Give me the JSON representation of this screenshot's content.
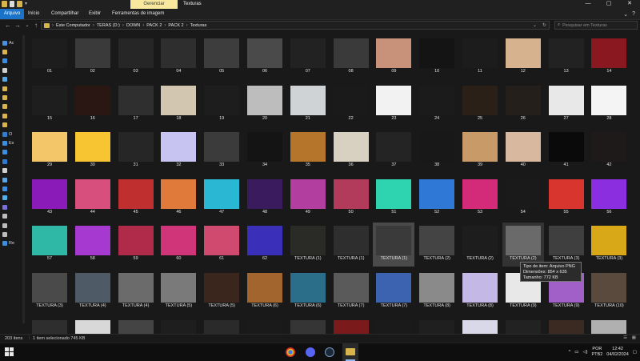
{
  "window": {
    "contextual_tab": "Gerenciar",
    "title": "Texturas",
    "controls": [
      "—",
      "▢",
      "✕"
    ]
  },
  "ribbon": {
    "tabs": [
      "Arquivo",
      "Início",
      "Compartilhar",
      "Exibir",
      "Ferramentas de imagem"
    ]
  },
  "address": {
    "crumbs": [
      "Este Computador",
      "TERAS (D:)",
      "DOWN",
      "PACK 2",
      "PACK 2",
      "Texturas"
    ],
    "separator": "›"
  },
  "search": {
    "placeholder": "Pesquisar em Texturas"
  },
  "sidebar": {
    "items": [
      {
        "label": "Ac",
        "icon": "star-icon",
        "color": "#4a90e2"
      },
      {
        "label": "",
        "icon": "folder-icon",
        "color": "#d8b44a"
      },
      {
        "label": "",
        "icon": "download-icon",
        "color": "#3b8fe0"
      },
      {
        "label": "",
        "icon": "document-icon",
        "color": "#cfcfcf"
      },
      {
        "label": "",
        "icon": "image-icon",
        "color": "#58a6e6"
      },
      {
        "label": "",
        "icon": "folder-icon",
        "color": "#d8b44a"
      },
      {
        "label": "",
        "icon": "folder-icon",
        "color": "#d8b44a"
      },
      {
        "label": "",
        "icon": "folder-icon",
        "color": "#d8b44a"
      },
      {
        "label": "",
        "icon": "folder-icon",
        "color": "#d8b44a"
      },
      {
        "label": "",
        "icon": "folder-icon",
        "color": "#d8b44a"
      },
      {
        "label": "O",
        "icon": "onedrive-icon",
        "color": "#2d7fd3"
      },
      {
        "label": "Es",
        "icon": "computer-icon",
        "color": "#3b8fe0"
      },
      {
        "label": "",
        "icon": "download-icon",
        "color": "#3b8fe0"
      },
      {
        "label": "",
        "icon": "desktop-icon",
        "color": "#2b7cd1"
      },
      {
        "label": "",
        "icon": "document-icon",
        "color": "#cfcfcf"
      },
      {
        "label": "",
        "icon": "image-icon",
        "color": "#58a6e6"
      },
      {
        "label": "",
        "icon": "music-icon",
        "color": "#3b8fe0"
      },
      {
        "label": "",
        "icon": "3d-objects-icon",
        "color": "#4db0e8"
      },
      {
        "label": "",
        "icon": "video-icon",
        "color": "#7a6fd6"
      },
      {
        "label": "",
        "icon": "drive-icon",
        "color": "#bdbdbd"
      },
      {
        "label": "",
        "icon": "drive-icon",
        "color": "#bdbdbd"
      },
      {
        "label": "",
        "icon": "drive-icon",
        "color": "#bdbdbd"
      },
      {
        "label": "Re",
        "icon": "network-icon",
        "color": "#3b8fe0"
      }
    ]
  },
  "files": [
    {
      "label": "01",
      "fill": "#1d1d1d"
    },
    {
      "label": "02",
      "fill": "#3a3a3a"
    },
    {
      "label": "03",
      "fill": "#262626"
    },
    {
      "label": "04",
      "fill": "#2e2e2e"
    },
    {
      "label": "05",
      "fill": "#3d3d3d"
    },
    {
      "label": "06",
      "fill": "#4a4a4a"
    },
    {
      "label": "07",
      "fill": "#222222"
    },
    {
      "label": "08",
      "fill": "#3a3a3a"
    },
    {
      "label": "09",
      "fill": "#c8927a"
    },
    {
      "label": "10",
      "fill": "#141414"
    },
    {
      "label": "11",
      "fill": "#1c1c1c"
    },
    {
      "label": "12",
      "fill": "#d7b28e"
    },
    {
      "label": "13",
      "fill": "#222222"
    },
    {
      "label": "14",
      "fill": "#8a1820"
    },
    {
      "label": "15",
      "fill": "#1e1e1e"
    },
    {
      "label": "16",
      "fill": "#2a1612"
    },
    {
      "label": "17",
      "fill": "#2f2f2f"
    },
    {
      "label": "18",
      "fill": "#d2c6b0"
    },
    {
      "label": "19",
      "fill": "#1d1d1d"
    },
    {
      "label": "20",
      "fill": "#bdbdbd"
    },
    {
      "label": "21",
      "fill": "#cfd3d6"
    },
    {
      "label": "22",
      "fill": "#1a1a1a"
    },
    {
      "label": "23",
      "fill": "#f2f2f2"
    },
    {
      "label": "24",
      "fill": "#1b1b1b"
    },
    {
      "label": "25",
      "fill": "#2a2018"
    },
    {
      "label": "26",
      "fill": "#241f1a"
    },
    {
      "label": "27",
      "fill": "#e8e8e8"
    },
    {
      "label": "28",
      "fill": "#f4f4f4"
    },
    {
      "label": "29",
      "fill": "#f3c66a"
    },
    {
      "label": "30",
      "fill": "#f7c531"
    },
    {
      "label": "31",
      "fill": "#262626"
    },
    {
      "label": "32",
      "fill": "#c8c4f2"
    },
    {
      "label": "33",
      "fill": "#3b3b3b"
    },
    {
      "label": "34",
      "fill": "#141414"
    },
    {
      "label": "35",
      "fill": "#b5762c"
    },
    {
      "label": "36",
      "fill": "#d8d0c0"
    },
    {
      "label": "37",
      "fill": "#242424"
    },
    {
      "label": "38",
      "fill": "#181818"
    },
    {
      "label": "39",
      "fill": "#c89a68"
    },
    {
      "label": "40",
      "fill": "#d8b89e"
    },
    {
      "label": "41",
      "fill": "#0a0a0a"
    },
    {
      "label": "42",
      "fill": "#1f1a1a"
    },
    {
      "label": "43",
      "fill": "#8a1bb8"
    },
    {
      "label": "44",
      "fill": "#d74f7c"
    },
    {
      "label": "45",
      "fill": "#c02f2f"
    },
    {
      "label": "46",
      "fill": "#e07a3b"
    },
    {
      "label": "47",
      "fill": "#2ab7d4"
    },
    {
      "label": "48",
      "fill": "#3a1b5e"
    },
    {
      "label": "49",
      "fill": "#b23f9f"
    },
    {
      "label": "50",
      "fill": "#b23a5a"
    },
    {
      "label": "51",
      "fill": "#2ed3b0"
    },
    {
      "label": "52",
      "fill": "#2f78d6"
    },
    {
      "label": "53",
      "fill": "#d42a7a"
    },
    {
      "label": "54",
      "fill": "#1a1a1a"
    },
    {
      "label": "55",
      "fill": "#d8352f"
    },
    {
      "label": "56",
      "fill": "#8b2ee0"
    },
    {
      "label": "57",
      "fill": "#2fb8a6"
    },
    {
      "label": "58",
      "fill": "#a63ad0"
    },
    {
      "label": "59",
      "fill": "#b02a4a"
    },
    {
      "label": "60",
      "fill": "#d0357a"
    },
    {
      "label": "61",
      "fill": "#d04a6f"
    },
    {
      "label": "62",
      "fill": "#3a2fb8"
    },
    {
      "label": "TEXTURA (1)",
      "fill": "#2a2a26"
    },
    {
      "label": "TEXTURA (1)",
      "fill": "#2e2e2e"
    },
    {
      "label": "TEXTURA (1)",
      "fill": "#3a3a3a",
      "selected": true
    },
    {
      "label": "TEXTURA (2)",
      "fill": "#444444"
    },
    {
      "label": "TEXTURA (2)",
      "fill": "#1d1d1d"
    },
    {
      "label": "TEXTURA (2)",
      "fill": "#6a6a6a",
      "hover": true
    },
    {
      "label": "TEXTURA (3)",
      "fill": "#3f3f3f"
    },
    {
      "label": "TEXTURA (3)",
      "fill": "#d9a818"
    },
    {
      "label": "TEXTURA (3)",
      "fill": "#4a4a4a"
    },
    {
      "label": "TEXTURA (4)",
      "fill": "#4e5a66"
    },
    {
      "label": "TEXTURA (4)",
      "fill": "#6b6b6b"
    },
    {
      "label": "TEXTURA (5)",
      "fill": "#7a7a7a"
    },
    {
      "label": "TEXTURA (5)",
      "fill": "#3a261c"
    },
    {
      "label": "TEXTURA (6)",
      "fill": "#a2652e"
    },
    {
      "label": "TEXTURA (6)",
      "fill": "#2a6e8a"
    },
    {
      "label": "TEXTURA (7)",
      "fill": "#5a5a5a"
    },
    {
      "label": "TEXTURA (7)",
      "fill": "#3b63b0"
    },
    {
      "label": "TEXTURA (8)",
      "fill": "#8a8a8a"
    },
    {
      "label": "TEXTURA (8)",
      "fill": "#c4b8e6"
    },
    {
      "label": "TEXTURA (9)",
      "fill": "#e8e8e8"
    },
    {
      "label": "TEXTURA (9)",
      "fill": "#a060c8"
    },
    {
      "label": "TEXTURA (10)",
      "fill": "#5a4a3e"
    },
    {
      "label": "",
      "fill": "#2e2e2e"
    },
    {
      "label": "",
      "fill": "#d8d8d8"
    },
    {
      "label": "",
      "fill": "#444444"
    },
    {
      "label": "",
      "fill": "#1e1e1e"
    },
    {
      "label": "",
      "fill": "#2a2a2a"
    },
    {
      "label": "",
      "fill": "#1a1a1a"
    },
    {
      "label": "",
      "fill": "#353535"
    },
    {
      "label": "",
      "fill": "#7a1a1a"
    },
    {
      "label": "",
      "fill": "#1a1a1a"
    },
    {
      "label": "",
      "fill": "#1f1f1f"
    },
    {
      "label": "",
      "fill": "#d8d8e8"
    },
    {
      "label": "",
      "fill": "#222222"
    },
    {
      "label": "",
      "fill": "#3a2a22"
    },
    {
      "label": "",
      "fill": "#b0b0b0"
    }
  ],
  "tooltip": {
    "type": "Tipo de item: Arquivo PNG",
    "dims": "Dimensões: 854 x 635",
    "size": "Tamanho: 772 KB"
  },
  "status": {
    "count": "203 itens",
    "selection": "1 item selecionado  745 KB"
  },
  "taskbar": {
    "lang1": "POR",
    "lang2": "PTB2",
    "time": "12:42",
    "date": "04/02/2024"
  }
}
